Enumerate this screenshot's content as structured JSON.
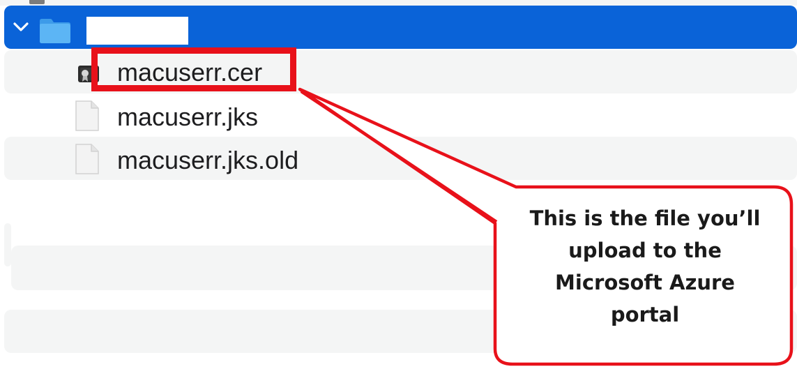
{
  "finder": {
    "folder": {
      "name": "",
      "expanded": true,
      "selected": true
    },
    "files": [
      {
        "name": "macuserr.cer",
        "icon": "certificate-icon"
      },
      {
        "name": "macuserr.jks",
        "icon": "document-icon"
      },
      {
        "name": "macuserr.jks.old",
        "icon": "document-icon"
      }
    ]
  },
  "annotation": {
    "callout_lines": [
      "This is the file you’ll",
      "upload to the",
      "Microsoft Azure",
      "portal"
    ],
    "highlight_color": "#e8111a"
  },
  "colors": {
    "selection": "#0a63d8",
    "row_alt": "#f4f5f5",
    "folder": "#4aa8f0"
  }
}
